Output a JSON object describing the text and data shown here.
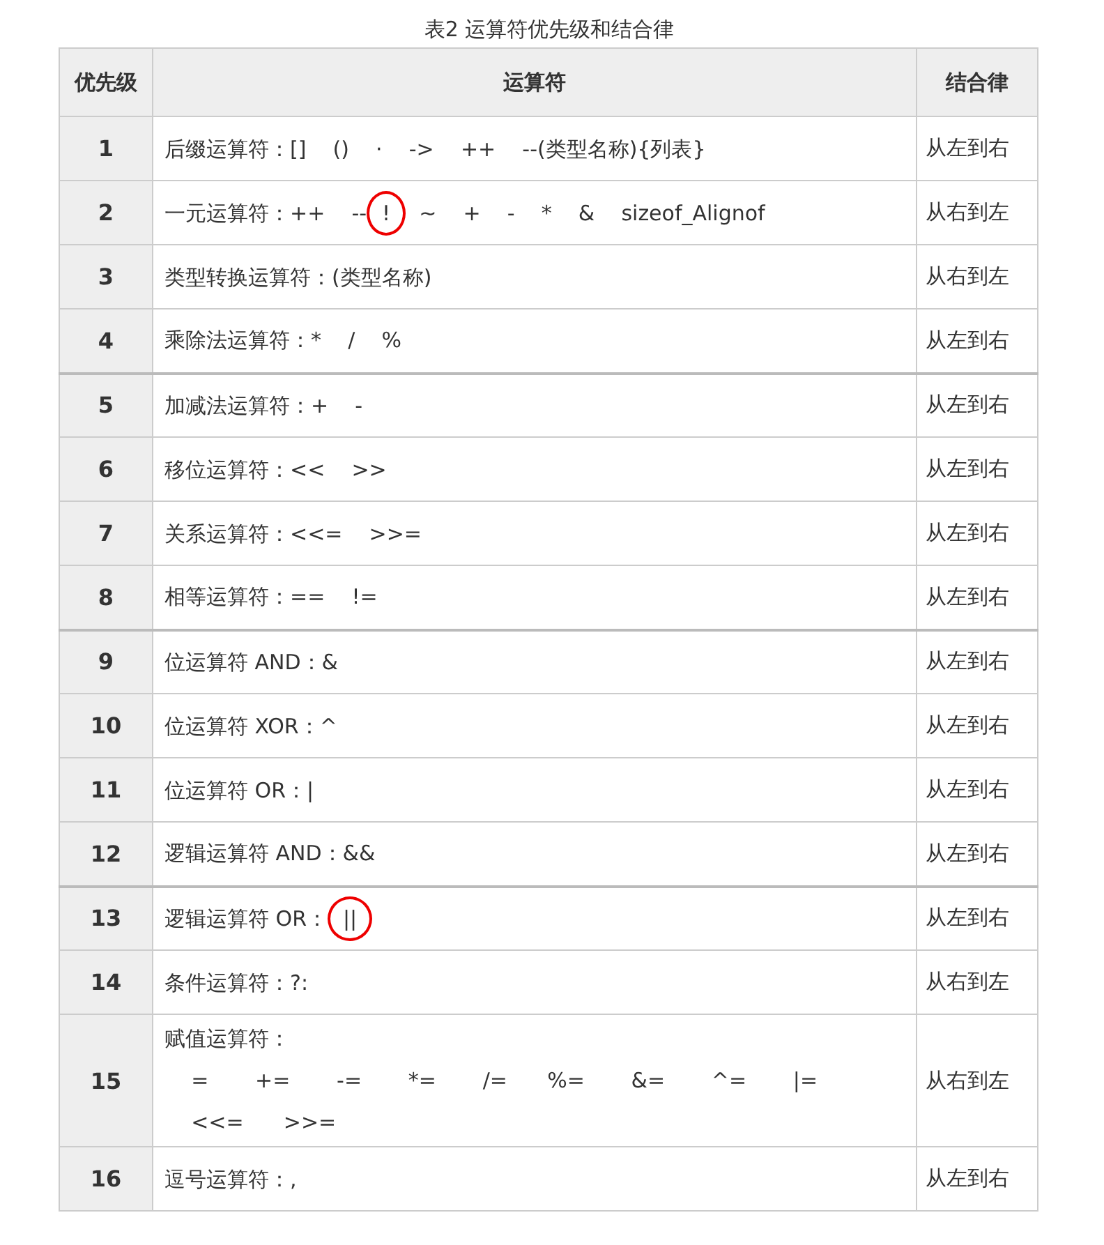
{
  "caption": "表2 运算符优先级和结合律",
  "columns": [
    "优先级",
    "运算符",
    "结合律"
  ],
  "rows": [
    {
      "level": "1",
      "lines": [
        [
          {
            "text": "后缀运算符：[]    ()    ·    ->    ++    --(类型名称){列表}",
            "circled": false
          }
        ]
      ],
      "assoc": "从左到右",
      "group_break": false
    },
    {
      "level": "2",
      "lines": [
        [
          {
            "text": "一元运算符：++    --",
            "circled": false
          },
          {
            "text": "!",
            "circled": true
          },
          {
            "text": "  ~    +    -    *    &    sizeof_Alignof",
            "circled": false
          }
        ]
      ],
      "assoc": "从右到左",
      "group_break": false
    },
    {
      "level": "3",
      "lines": [
        [
          {
            "text": "类型转换运算符：(类型名称)",
            "circled": false
          }
        ]
      ],
      "assoc": "从右到左",
      "group_break": false
    },
    {
      "level": "4",
      "lines": [
        [
          {
            "text": "乘除法运算符：*    /    %",
            "circled": false
          }
        ]
      ],
      "assoc": "从左到右",
      "group_break": true
    },
    {
      "level": "5",
      "lines": [
        [
          {
            "text": "加减法运算符：+    -",
            "circled": false
          }
        ]
      ],
      "assoc": "从左到右",
      "group_break": false
    },
    {
      "level": "6",
      "lines": [
        [
          {
            "text": "移位运算符：<<    >>",
            "circled": false
          }
        ]
      ],
      "assoc": "从左到右",
      "group_break": false
    },
    {
      "level": "7",
      "lines": [
        [
          {
            "text": "关系运算符：<<=    >>=",
            "circled": false
          }
        ]
      ],
      "assoc": "从左到右",
      "group_break": false
    },
    {
      "level": "8",
      "lines": [
        [
          {
            "text": "相等运算符：==    !=",
            "circled": false
          }
        ]
      ],
      "assoc": "从左到右",
      "group_break": true
    },
    {
      "level": "9",
      "lines": [
        [
          {
            "text": "位运算符 AND：&",
            "circled": false
          }
        ]
      ],
      "assoc": "从左到右",
      "group_break": false
    },
    {
      "level": "10",
      "lines": [
        [
          {
            "text": "位运算符 XOR：^",
            "circled": false
          }
        ]
      ],
      "assoc": "从左到右",
      "group_break": false
    },
    {
      "level": "11",
      "lines": [
        [
          {
            "text": "位运算符 OR：|",
            "circled": false
          }
        ]
      ],
      "assoc": "从左到右",
      "group_break": false
    },
    {
      "level": "12",
      "lines": [
        [
          {
            "text": "逻辑运算符 AND：&&",
            "circled": false
          }
        ]
      ],
      "assoc": "从左到右",
      "group_break": true
    },
    {
      "level": "13",
      "lines": [
        [
          {
            "text": "逻辑运算符 OR：",
            "circled": false
          },
          {
            "text": "||",
            "circled": true
          }
        ]
      ],
      "assoc": "从左到右",
      "group_break": false
    },
    {
      "level": "14",
      "lines": [
        [
          {
            "text": "条件运算符：?:",
            "circled": false
          }
        ]
      ],
      "assoc": "从右到左",
      "group_break": false
    },
    {
      "level": "15",
      "lines": [
        [
          {
            "text": "赋值运算符：",
            "circled": false
          }
        ],
        [
          {
            "text": "    =       +=       -=       *=       /=      %=       &=       ^=       |=",
            "circled": false
          }
        ],
        [
          {
            "text": "    <<=      >>=",
            "circled": false
          }
        ]
      ],
      "assoc": "从右到左",
      "group_break": false
    },
    {
      "level": "16",
      "lines": [
        [
          {
            "text": "逗号运算符：,",
            "circled": false
          }
        ]
      ],
      "assoc": "从左到右",
      "group_break": false
    }
  ]
}
